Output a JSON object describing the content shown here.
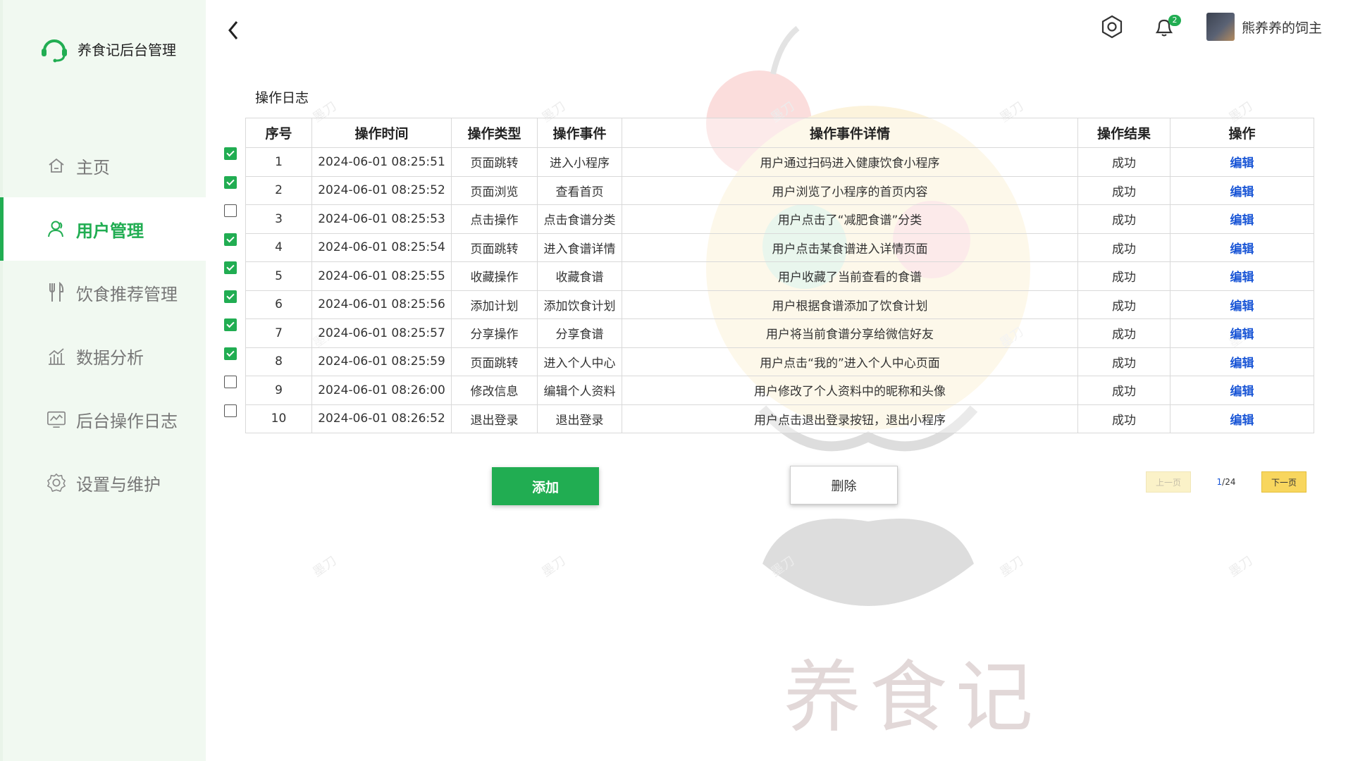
{
  "brand": {
    "name": "养食记后台管理"
  },
  "nav": [
    {
      "label": "主页",
      "icon": "home-icon",
      "active": false
    },
    {
      "label": "用户管理",
      "icon": "user-icon",
      "active": true
    },
    {
      "label": "饮食推荐管理",
      "icon": "fork-knife-icon",
      "active": false
    },
    {
      "label": "数据分析",
      "icon": "chart-icon",
      "active": false
    },
    {
      "label": "后台操作日志",
      "icon": "monitor-log-icon",
      "active": false
    },
    {
      "label": "设置与维护",
      "icon": "settings-icon",
      "active": false
    }
  ],
  "header": {
    "notification_count": "2",
    "user_name": "熊养养的饲主"
  },
  "page": {
    "title": "操作日志"
  },
  "table": {
    "headers": [
      "序号",
      "操作时间",
      "操作类型",
      "操作事件",
      "操作事件详情",
      "操作结果",
      "操作"
    ],
    "rows": [
      {
        "checked": true,
        "cells": [
          "1",
          "2024-06-01    08:25:51",
          "页面跳转",
          "进入小程序",
          "用户通过扫码进入健康饮食小程序",
          "成功",
          "编辑"
        ]
      },
      {
        "checked": true,
        "cells": [
          "2",
          "2024-06-01    08:25:52",
          "页面浏览",
          "查看首页",
          "用户浏览了小程序的首页内容",
          "成功",
          "编辑"
        ]
      },
      {
        "checked": false,
        "cells": [
          "3",
          "2024-06-01    08:25:53",
          "点击操作",
          "点击食谱分类",
          "用户点击了“减肥食谱”分类",
          "成功",
          "编辑"
        ]
      },
      {
        "checked": true,
        "cells": [
          "4",
          "2024-06-01    08:25:54",
          "页面跳转",
          "进入食谱详情",
          "用户点击某食谱进入详情页面",
          "成功",
          "编辑"
        ]
      },
      {
        "checked": true,
        "cells": [
          "5",
          "2024-06-01    08:25:55",
          "收藏操作",
          "收藏食谱",
          "用户收藏了当前查看的食谱",
          "成功",
          "编辑"
        ]
      },
      {
        "checked": true,
        "cells": [
          "6",
          "2024-06-01    08:25:56",
          "添加计划",
          "添加饮食计划",
          "用户根据食谱添加了饮食计划",
          "成功",
          "编辑"
        ]
      },
      {
        "checked": true,
        "cells": [
          "7",
          "2024-06-01    08:25:57",
          "分享操作",
          "分享食谱",
          "用户将当前食谱分享给微信好友",
          "成功",
          "编辑"
        ]
      },
      {
        "checked": true,
        "cells": [
          "8",
          "2024-06-01    08:25:59",
          "页面跳转",
          "进入个人中心",
          "用户点击“我的”进入个人中心页面",
          "成功",
          "编辑"
        ]
      },
      {
        "checked": false,
        "cells": [
          "9",
          "2024-06-01    08:26:00",
          "修改信息",
          "编辑个人资料",
          "用户修改了个人资料中的昵称和头像",
          "成功",
          "编辑"
        ]
      },
      {
        "checked": false,
        "cells": [
          "10",
          "2024-06-01    08:26:52",
          "退出登录",
          "退出登录",
          "用户点击退出登录按钮，退出小程序",
          "成功",
          "编辑"
        ]
      }
    ]
  },
  "actions": {
    "add_label": "添加",
    "delete_label": "删除"
  },
  "pager": {
    "prev_label": "上一页",
    "current": "1",
    "total": "/24",
    "next_label": "下一页"
  },
  "watermark": {
    "text": "墨刀",
    "mascot_text": "养食记"
  },
  "colors": {
    "accent": "#21ad52",
    "link": "#1a56d6",
    "sidebar_bg": "#f1f9f1",
    "next_btn": "#f8d65e"
  }
}
